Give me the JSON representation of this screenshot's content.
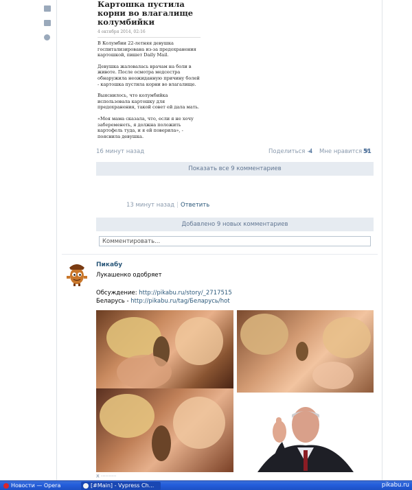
{
  "article": {
    "title": "Картошка пустила корни во влагалище колумбийки",
    "date": "4 октября 2014, 02:16",
    "paragraphs": [
      "В Колумбии 22-летняя девушка госпитализирована из-за предохранения картошкой, пишет Daily Mail.",
      "Девушка жаловалась врачам на боли в животе. После осмотра медсестра обнаружила неожиданную причину болей - картошка пустила корни во влагалище.",
      "Выяснилось, что колумбийка использовала картошку для предохранения, такой совет ей дала мать.",
      "«Моя мама сказала, что, если я не хочу забеременеть, я должна положить картофель туда, и я ей поверила», - пояснила девушка."
    ]
  },
  "post_meta": {
    "time": "16 минут назад",
    "share_label": "Поделиться",
    "share_count": "4",
    "like_label": "Мне нравится",
    "like_count": "51"
  },
  "show_all_comments": "Показать все 9 комментариев",
  "reply_row": {
    "time": "13 минут назад",
    "separator": "|",
    "reply_label": "Ответить"
  },
  "new_comments": "Добавлено 9 новых комментариев",
  "comment_input": {
    "placeholder": "Комментировать..."
  },
  "post": {
    "author": "Пикабу",
    "line1": "Лукашенко одобряет",
    "discussion_label": "Обсуждение: ",
    "discussion_link": "http://pikabu.ru/story/_2717515",
    "belarus_label": "Беларусь - ",
    "belarus_link": "http://pikabu.ru/tag/Беларусь/hot"
  },
  "taskbar": {
    "item1": "Новости — Opera",
    "item2": "[#Main] - Vypress Ch..."
  },
  "watermark": "pikabu.ru",
  "colors": {
    "link": "#2b587a",
    "grey_bar": "#e6ebf1",
    "meta": "#8a9aad",
    "taskbar": "#245edc"
  }
}
